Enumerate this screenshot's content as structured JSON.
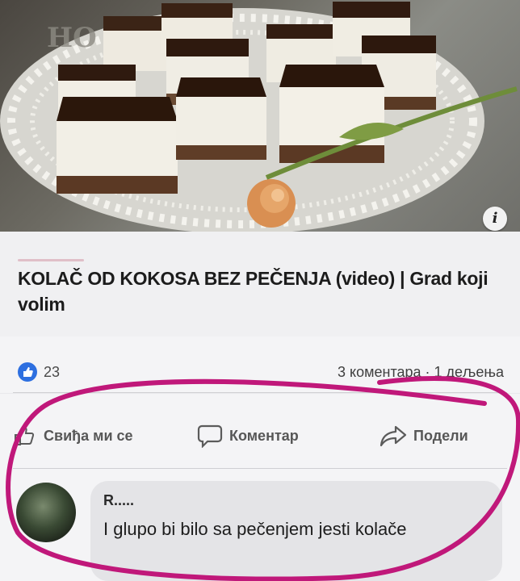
{
  "post_image": {
    "alt_icon": "info-icon",
    "watermark": "HO"
  },
  "link_preview": {
    "title": "KOLAČ OD KOKOSA BEZ PEČENJA (video) | Grad koji volim"
  },
  "stats": {
    "likes": "23",
    "comments_shares": "3 коментара · 1 дељења"
  },
  "actions": {
    "like": "Свиђа ми се",
    "comment": "Коментар",
    "share": "Подели"
  },
  "comment": {
    "author": "R.....",
    "text": "I glupo bi bilo sa pečenjem jesti kolače"
  },
  "colors": {
    "like_blue": "#2d6fe0",
    "marker": "#c0187a"
  }
}
